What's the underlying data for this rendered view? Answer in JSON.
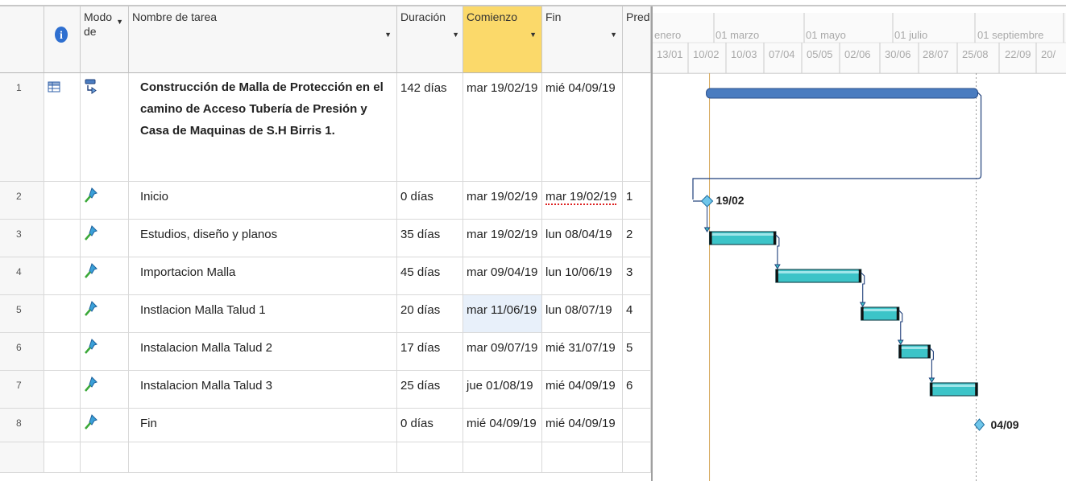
{
  "headers": {
    "num": "",
    "info_icon": "info-icon",
    "mode": "Modo de",
    "name": "Nombre de tarea",
    "duration": "Duración",
    "start": "Comienzo",
    "finish": "Fin",
    "pred": "Pred"
  },
  "timescale": {
    "top": [
      "enero",
      "01 marzo",
      "01 mayo",
      "01 julio",
      "01 septiembre"
    ],
    "bottom": [
      "13/01",
      "10/02",
      "10/03",
      "07/04",
      "05/05",
      "02/06",
      "30/06",
      "28/07",
      "25/08",
      "22/09",
      "20/"
    ]
  },
  "tasks": [
    {
      "id": "1",
      "icon": "summary-task-icon",
      "mode": "auto-schedule-icon",
      "name": "Construcción de Malla de Protección en el camino de Acceso Tubería de Presión y Casa de Maquinas de S.H Birris 1.",
      "duration": "142 días",
      "start": "mar 19/02/19",
      "finish": "mié 04/09/19",
      "pred": "",
      "bold": true
    },
    {
      "id": "2",
      "icon": "",
      "mode": "manual-pin-icon",
      "name": "Inicio",
      "duration": "0 días",
      "start": "mar 19/02/19",
      "finish": "mar 19/02/19",
      "pred": "1"
    },
    {
      "id": "3",
      "icon": "",
      "mode": "manual-pin-icon",
      "name": "Estudios, diseño y planos",
      "duration": "35 días",
      "start": "mar 19/02/19",
      "finish": "lun 08/04/19",
      "pred": "2"
    },
    {
      "id": "4",
      "icon": "",
      "mode": "manual-pin-icon",
      "name": "Importacion Malla",
      "duration": "45 días",
      "start": "mar 09/04/19",
      "finish": "lun 10/06/19",
      "pred": "3"
    },
    {
      "id": "5",
      "icon": "",
      "mode": "manual-pin-icon",
      "name": "Instlacion Malla Talud 1",
      "duration": "20 días",
      "start": "mar 11/06/19",
      "finish": "lun 08/07/19",
      "pred": "4"
    },
    {
      "id": "6",
      "icon": "",
      "mode": "manual-pin-icon",
      "name": "Instalacion Malla Talud 2",
      "duration": "17 días",
      "start": "mar 09/07/19",
      "finish": "mié 31/07/19",
      "pred": "5"
    },
    {
      "id": "7",
      "icon": "",
      "mode": "manual-pin-icon",
      "name": "Instalacion Malla Talud 3",
      "duration": "25 días",
      "start": "jue 01/08/19",
      "finish": "mié 04/09/19",
      "pred": "6"
    },
    {
      "id": "8",
      "icon": "",
      "mode": "manual-pin-icon",
      "name": "Fin",
      "duration": "0 días",
      "start": "mié 04/09/19",
      "finish": "mié 04/09/19",
      "pred": ""
    }
  ],
  "milestones": {
    "start_label": "19/02",
    "end_label": "04/09"
  },
  "colors": {
    "summary_bar": "#4a7cc0",
    "task_bar": "#3cc4c8",
    "link": "#1f3f7a",
    "today_line": "#d6a85a",
    "highlight_header": "#fbd96a"
  }
}
